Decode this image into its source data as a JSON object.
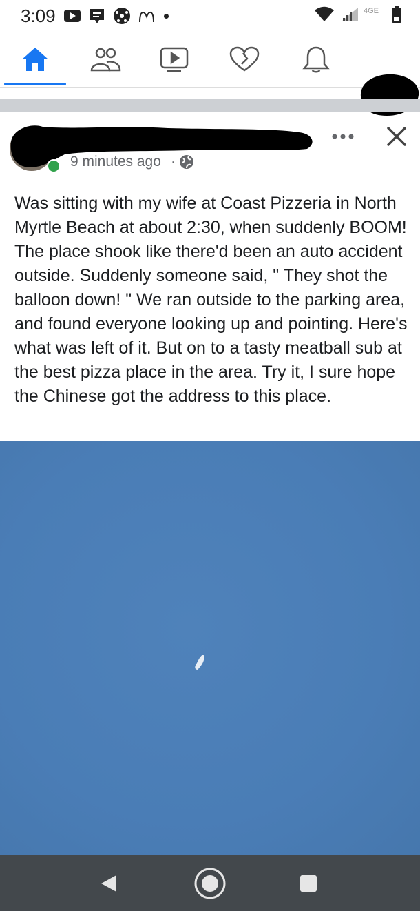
{
  "status_bar": {
    "time": "3:09",
    "icons": [
      "play-icon",
      "message-icon",
      "soccer-ball-icon",
      "mcdonalds-icon",
      "dot-icon"
    ],
    "network_label": "4GE",
    "right_icons": [
      "wifi-icon",
      "signal-icon",
      "battery-icon"
    ]
  },
  "nav": {
    "items": [
      {
        "name": "home",
        "icon": "home-icon",
        "active": true
      },
      {
        "name": "friends",
        "icon": "friends-icon",
        "active": false
      },
      {
        "name": "watch",
        "icon": "video-icon",
        "active": false
      },
      {
        "name": "dating",
        "icon": "heart-icon",
        "active": false
      },
      {
        "name": "notifications",
        "icon": "bell-icon",
        "active": false
      },
      {
        "name": "profile",
        "icon": "avatar-icon",
        "active": false
      }
    ],
    "accent_color": "#1877f2"
  },
  "post": {
    "author": "",
    "timestamp": "9 minutes ago",
    "separator": "·",
    "audience_icon": "globe-icon",
    "text": "Was sitting with my wife at Coast Pizzeria in North Myrtle Beach at about 2:30, when suddenly BOOM! The place shook like there'd been an auto accident outside. Suddenly someone said, \" They shot the balloon down! \" We ran outside to the parking area, and found everyone looking up and pointing. Here's what was left of it. But on to a tasty meatball sub at the best pizza place in the area. Try it, I sure hope the Chinese got the address to this place.",
    "photo_color": "#4b7eb5"
  },
  "system_nav": {
    "buttons": [
      "back-icon",
      "home-circle-icon",
      "recents-icon"
    ]
  }
}
